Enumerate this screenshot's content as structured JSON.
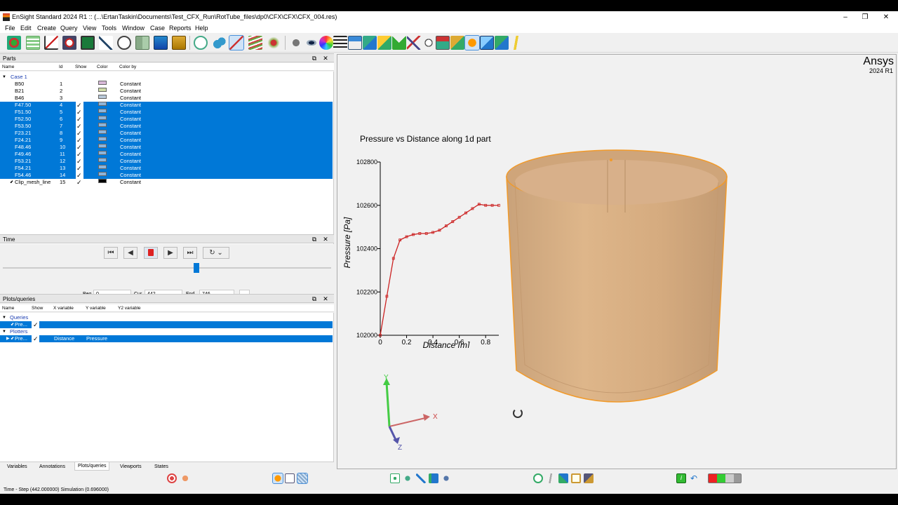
{
  "window": {
    "title": "EnSight Standard 2024 R1 :: (...\\ErtanTaskin\\Documents\\Test_CFX_Run\\RotTube_files\\dp0\\CFX\\CFX\\CFX_004.res)",
    "minimize": "–",
    "maximize": "❐",
    "close": "✕"
  },
  "menu": [
    "File",
    "Edit",
    "Create",
    "Query",
    "View",
    "Tools",
    "Window",
    "Case",
    "Reports",
    "Help"
  ],
  "parts": {
    "panel_title": "Parts",
    "columns": [
      "Name",
      "Id",
      "Show",
      "Color",
      "Color by"
    ],
    "case_label": "Case 1",
    "rows": [
      {
        "name": "B50",
        "id": "1",
        "show": "",
        "color": "#d8b8d8",
        "color_by": "Constant",
        "selected": false
      },
      {
        "name": "B21",
        "id": "2",
        "show": "",
        "color": "#d0dca8",
        "color_by": "Constant",
        "selected": false
      },
      {
        "name": "B46",
        "id": "3",
        "show": "",
        "color": "#b8c8d8",
        "color_by": "Constant",
        "selected": false
      },
      {
        "name": "F47.50",
        "id": "4",
        "show": "✓",
        "color": "#8fb4d8",
        "color_by": "Constant",
        "selected": true
      },
      {
        "name": "F51.50",
        "id": "5",
        "show": "✓",
        "color": "#8fb4d8",
        "color_by": "Constant",
        "selected": true
      },
      {
        "name": "F52.50",
        "id": "6",
        "show": "✓",
        "color": "#8fb4d8",
        "color_by": "Constant",
        "selected": true
      },
      {
        "name": "F53.50",
        "id": "7",
        "show": "✓",
        "color": "#8fb4d8",
        "color_by": "Constant",
        "selected": true
      },
      {
        "name": "F23.21",
        "id": "8",
        "show": "✓",
        "color": "#8fb4d8",
        "color_by": "Constant",
        "selected": true
      },
      {
        "name": "F24.21",
        "id": "9",
        "show": "✓",
        "color": "#8fb4d8",
        "color_by": "Constant",
        "selected": true
      },
      {
        "name": "F48.46",
        "id": "10",
        "show": "✓",
        "color": "#8fb4d8",
        "color_by": "Constant",
        "selected": true
      },
      {
        "name": "F49.46",
        "id": "11",
        "show": "✓",
        "color": "#8fb4d8",
        "color_by": "Constant",
        "selected": true
      },
      {
        "name": "F53.21",
        "id": "12",
        "show": "✓",
        "color": "#8fb4d8",
        "color_by": "Constant",
        "selected": true
      },
      {
        "name": "F54.21",
        "id": "13",
        "show": "✓",
        "color": "#8fb4d8",
        "color_by": "Constant",
        "selected": true
      },
      {
        "name": "F54.46",
        "id": "14",
        "show": "✓",
        "color": "#8fb4d8",
        "color_by": "Constant",
        "selected": true
      },
      {
        "name": "Clip_mesh_line",
        "id": "15",
        "show": "✓",
        "color": "#000000",
        "color_by": "Constant",
        "selected": false
      }
    ]
  },
  "time": {
    "panel_title": "Time",
    "beg_label": "Beg",
    "beg_value": "0",
    "cur_label": "Cur",
    "cur_value": "442",
    "end_label": "End",
    "end_value": "746",
    "more_button": "...",
    "slider_position": 0.592
  },
  "plots": {
    "panel_title": "Plots/queries",
    "columns": [
      "Name",
      "Show",
      "X variable",
      "Y variable",
      "Y2 variable"
    ],
    "queries_label": "Queries",
    "query_name": "Pre...",
    "plotters_label": "Plotters",
    "plotter_name": "Pre...",
    "plotter_x": "Distance",
    "plotter_y": "Pressure",
    "show_mark": "✓"
  },
  "tabs": [
    "Variables",
    "Annotations",
    "Plots/queries",
    "Viewports",
    "States"
  ],
  "active_tab": "Plots/queries",
  "viewport": {
    "brand": "Ansys",
    "version": "2024 R1",
    "axis_x": "X",
    "axis_y": "Y",
    "axis_z": "Z"
  },
  "chart_data": {
    "type": "line",
    "title": "Pressure vs Distance along 1d part",
    "xlabel": "Distance [m]",
    "ylabel": "Pressure [Pa]",
    "xlim": [
      0,
      0.9
    ],
    "ylim": [
      102000,
      102800
    ],
    "xticks": [
      "0",
      "0.2",
      "0.4",
      "0.6",
      "0.8"
    ],
    "yticks": [
      "102000",
      "102200",
      "102400",
      "102600",
      "102800"
    ],
    "series": [
      {
        "color": "#cc2222",
        "x": [
          0,
          0.05,
          0.1,
          0.15,
          0.2,
          0.25,
          0.3,
          0.35,
          0.4,
          0.45,
          0.5,
          0.55,
          0.6,
          0.65,
          0.7,
          0.75,
          0.8,
          0.85,
          0.9
        ],
        "y": [
          102000,
          102180,
          102355,
          102440,
          102455,
          102465,
          102470,
          102470,
          102475,
          102485,
          102505,
          102525,
          102545,
          102565,
          102585,
          102605,
          102600,
          102600,
          102600
        ]
      }
    ]
  },
  "status": "Time - Step (442.000000) Simulation (0.696000)"
}
